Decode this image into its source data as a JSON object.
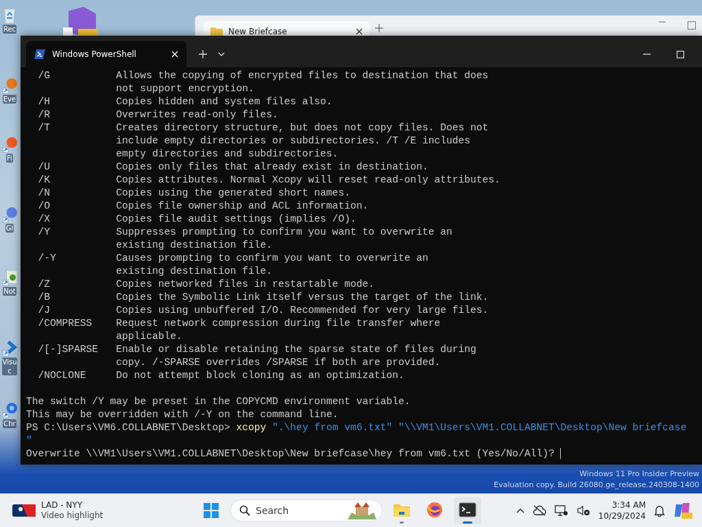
{
  "desktop_icons": [
    {
      "kind": "recycle-bin",
      "label": "Rec"
    },
    {
      "kind": "eve",
      "label": "Eve"
    },
    {
      "kind": "fire",
      "label": "Fi"
    },
    {
      "kind": "blue-circle",
      "label": "Gi"
    },
    {
      "kind": "notepad",
      "label": "Not"
    },
    {
      "kind": "visual",
      "label": "Visu\nc"
    },
    {
      "kind": "chrome",
      "label": "Chr"
    }
  ],
  "background_window": {
    "tab_title": "New Briefcase"
  },
  "terminal": {
    "tab_title": "Windows PowerShell",
    "switches": [
      {
        "option": "/G",
        "lines": [
          "Allows the copying of encrypted files to destination that does",
          "not support encryption."
        ]
      },
      {
        "option": "/H",
        "lines": [
          "Copies hidden and system files also."
        ]
      },
      {
        "option": "/R",
        "lines": [
          "Overwrites read-only files."
        ]
      },
      {
        "option": "/T",
        "lines": [
          "Creates directory structure, but does not copy files. Does not",
          "include empty directories or subdirectories. /T /E includes",
          "empty directories and subdirectories."
        ]
      },
      {
        "option": "/U",
        "lines": [
          "Copies only files that already exist in destination."
        ]
      },
      {
        "option": "/K",
        "lines": [
          "Copies attributes. Normal Xcopy will reset read-only attributes."
        ]
      },
      {
        "option": "/N",
        "lines": [
          "Copies using the generated short names."
        ]
      },
      {
        "option": "/O",
        "lines": [
          "Copies file ownership and ACL information."
        ]
      },
      {
        "option": "/X",
        "lines": [
          "Copies file audit settings (implies /O)."
        ]
      },
      {
        "option": "/Y",
        "lines": [
          "Suppresses prompting to confirm you want to overwrite an",
          "existing destination file."
        ]
      },
      {
        "option": "/-Y",
        "lines": [
          "Causes prompting to confirm you want to overwrite an",
          "existing destination file."
        ]
      },
      {
        "option": "/Z",
        "lines": [
          "Copies networked files in restartable mode."
        ]
      },
      {
        "option": "/B",
        "lines": [
          "Copies the Symbolic Link itself versus the target of the link."
        ]
      },
      {
        "option": "/J",
        "lines": [
          "Copies using unbuffered I/O. Recommended for very large files."
        ]
      },
      {
        "option": "/COMPRESS",
        "lines": [
          "Request network compression during file transfer where",
          "applicable."
        ]
      },
      {
        "option": "/[-]SPARSE",
        "lines": [
          "Enable or disable retaining the sparse state of files during",
          "copy. /-SPARSE overrides /SPARSE if both are provided."
        ]
      },
      {
        "option": "/NOCLONE",
        "lines": [
          "Do not attempt block cloning as an optimization."
        ]
      }
    ],
    "notes": [
      "The switch /Y may be preset in the COPYCMD environment variable.",
      "This may be overridden with /-Y on the command line."
    ],
    "prompt": "PS C:\\Users\\VM6.COLLABNET\\Desktop>",
    "command": "xcopy",
    "arguments": [
      "\".\\hey from vm6.txt\"",
      "\"\\\\VM1\\Users\\VM1.COLLABNET\\Desktop\\New briefcase"
    ],
    "continuation": "\"",
    "question": "Overwrite \\\\VM1\\Users\\VM1.COLLABNET\\Desktop\\New briefcase\\hey from vm6.txt (Yes/No/All)?"
  },
  "watermark": [
    "Windows 11 Pro Insider Preview",
    "Evaluation copy. Build 26080.ge_release.240308-1400"
  ],
  "taskbar": {
    "widget": {
      "title": "LAD - NYY",
      "subtitle": "Video highlight"
    },
    "search": {
      "placeholder": "Search"
    },
    "apps": [
      {
        "kind": "explorer",
        "running": true,
        "selected": false
      },
      {
        "kind": "firefox",
        "running": false,
        "selected": false
      },
      {
        "kind": "terminal",
        "running": true,
        "selected": true
      }
    ],
    "time": "3:34 AM",
    "date": "10/29/2024"
  }
}
